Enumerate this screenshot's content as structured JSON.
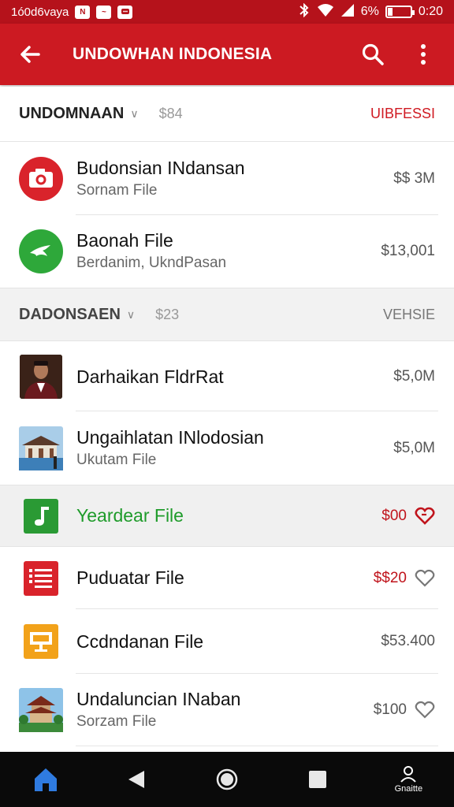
{
  "status_bar": {
    "left_text": "1ó0d6vaya",
    "mini_icons": [
      "N",
      "~"
    ],
    "battery_text": "6%",
    "time": "0:20"
  },
  "app_bar": {
    "title": "UNDOWHAN INDONESIA"
  },
  "sections": [
    {
      "title": "UNDOMNAAN",
      "total": "$84",
      "action": "UIBFESSI",
      "action_color": "#d01a22"
    },
    {
      "title": "DADONSAEN",
      "total": "$23",
      "action": "VEHSIE",
      "action_color": "#777777"
    }
  ],
  "rows": [
    {
      "primary": "Budonsian INdansan",
      "secondary": "Sornam File",
      "price": "$$ 3M",
      "icon": "camera-icon"
    },
    {
      "primary": "Baonah File",
      "secondary": "Berdanim, UkndPasan",
      "price": "$13,001",
      "icon": "bird-icon"
    },
    {
      "primary": "Darhaikan FldrRat",
      "secondary": "",
      "price": "$5,0M",
      "icon": "portrait-photo"
    },
    {
      "primary": "Ungaihlatan INlodosian",
      "secondary": "Ukutam File",
      "price": "$5,0M",
      "icon": "building-photo"
    },
    {
      "primary": "Yeardear File",
      "secondary": "",
      "price": "$00",
      "icon": "music-file-icon",
      "highlighted": true
    },
    {
      "primary": "Puduatar File",
      "secondary": "",
      "price": "$$20",
      "icon": "document-list-icon"
    },
    {
      "primary": "Ccdndanan File",
      "secondary": "",
      "price": "$53.400",
      "icon": "presentation-icon"
    },
    {
      "primary": "Undaluncian INaban",
      "secondary": "Sorzam File",
      "price": "$100",
      "icon": "pagoda-photo"
    }
  ],
  "nav": {
    "profile_label": "Gnaitte"
  },
  "colors": {
    "app_bar": "#cc1a22",
    "status_bar": "#b5121b",
    "accent_red": "#d01a22",
    "accent_green": "#1e9b2a"
  }
}
